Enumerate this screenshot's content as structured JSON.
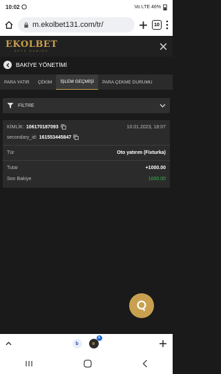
{
  "status": {
    "time": "10:02",
    "right": "Vo LTE 46% "
  },
  "browser": {
    "url": "m.ekolbet131.com/tr/",
    "tab_count": "10"
  },
  "site": {
    "logo": "EKOLBET",
    "logo_sub": "BETS GAMING"
  },
  "page": {
    "title": "BAKİYE YÖNETİMİ"
  },
  "tabs": [
    {
      "label": "PARA YATIR"
    },
    {
      "label": "ÇEKİM"
    },
    {
      "label": "İŞLEM GEÇMİŞİ"
    },
    {
      "label": "PARA ÇEKME DURUMU"
    }
  ],
  "filter": {
    "label": "FİLTRE"
  },
  "transaction": {
    "id_label": "KİMLİK:",
    "id_value": "106170187093",
    "date": "10.01.2023, 18:07",
    "secondary_label": "secondary_id:",
    "secondary_value": "161553445847",
    "type_label": "Tür",
    "type_value": "Oto yatırım (Fixturka)",
    "amount_label": "Tutar",
    "amount_value": "+1000.00",
    "balance_label": "Son Bakiye",
    "balance_value": "1000.00"
  },
  "colors": {
    "accent": "#c9a04f",
    "positive": "#3bb54a",
    "background": "#1a1a1a"
  }
}
